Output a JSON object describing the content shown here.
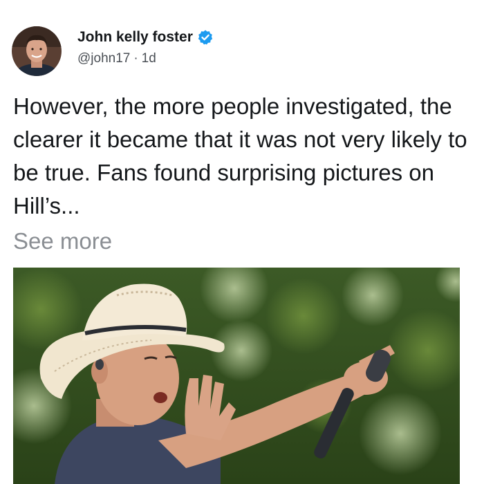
{
  "post": {
    "author": {
      "display_name": "John kelly foster",
      "handle": "@john17",
      "separator": "·",
      "time": "1d",
      "verified_icon": "verified-badge-icon",
      "avatar_icon": "user-avatar"
    },
    "text": "However, the more people investigated, the clearer it became that it was not very likely to be true. Fans found surprising pictures on Hill’s...",
    "see_more_label": "See more",
    "media": {
      "kind": "photo",
      "subject": "performer in straw cowboy hat holding microphone"
    }
  },
  "colors": {
    "text_primary": "#14171a",
    "text_secondary": "#4a4f55",
    "text_muted": "#8a8e93",
    "verified_blue": "#1d9bf0",
    "background": "#ffffff"
  }
}
